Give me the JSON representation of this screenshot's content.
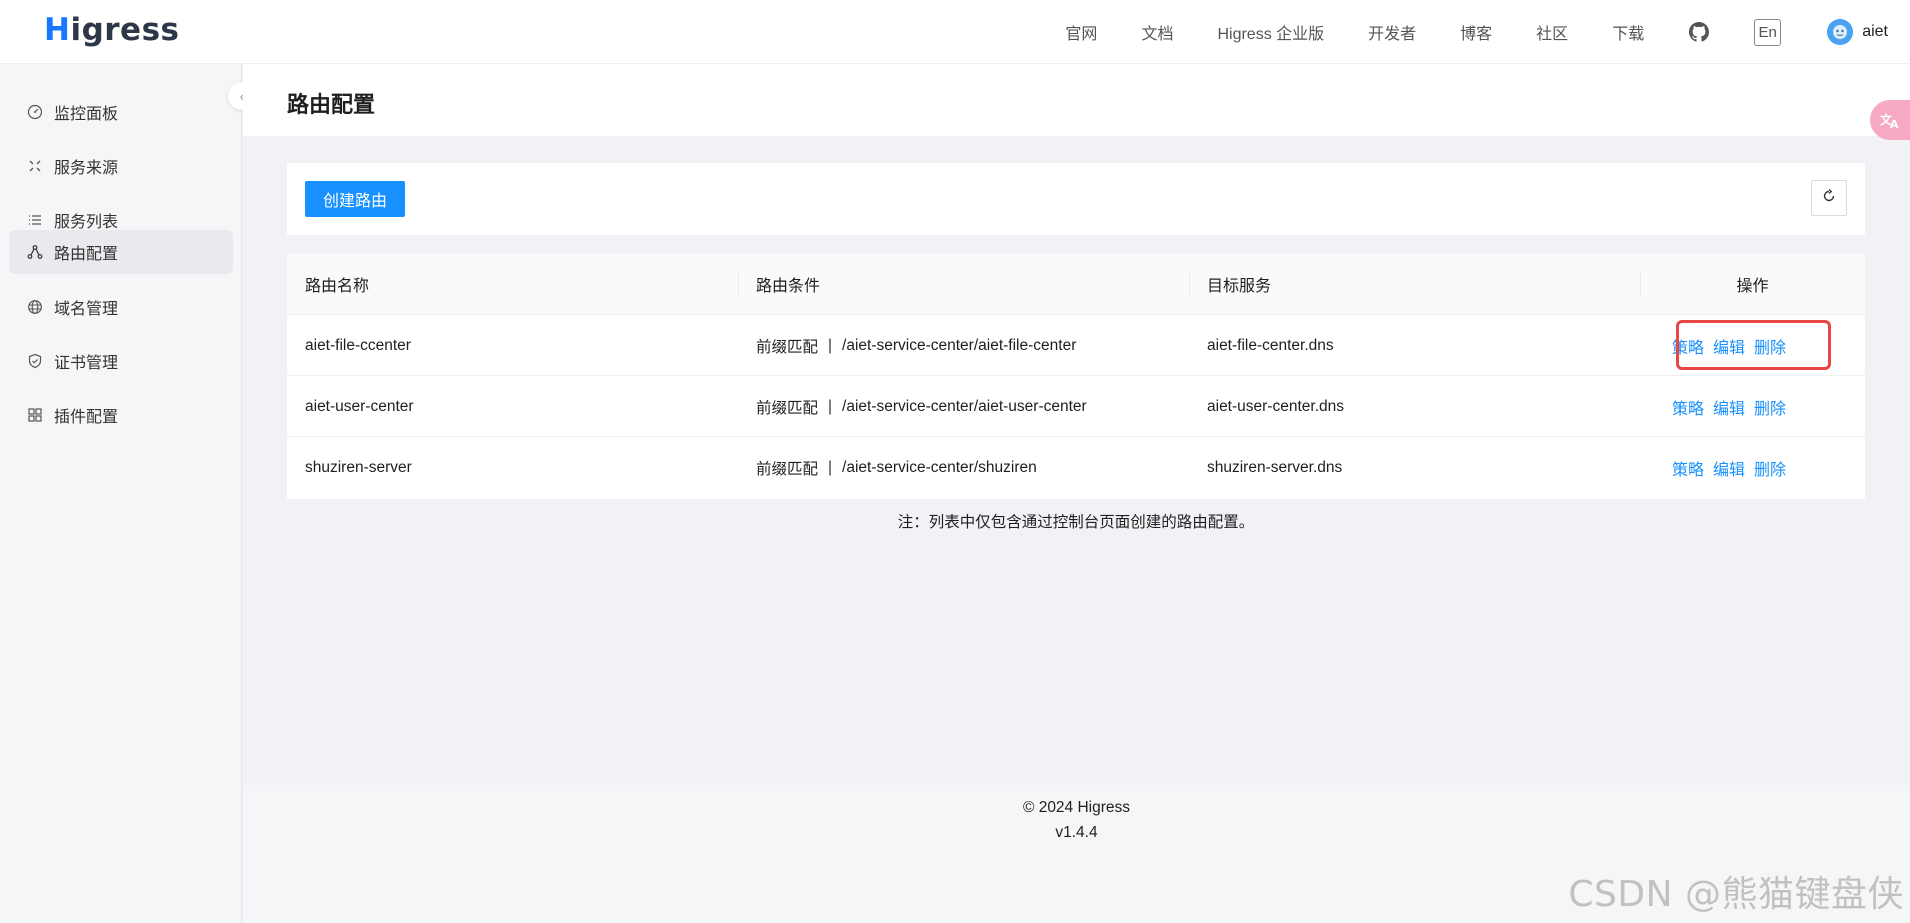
{
  "header": {
    "logo_mark": "H",
    "logo_rest": "igress",
    "nav": [
      "官网",
      "文档",
      "Higress 企业版",
      "开发者",
      "博客",
      "社区",
      "下载"
    ],
    "github_icon": "github-icon",
    "lang_label": "En",
    "user_name": "aiet"
  },
  "sidebar": {
    "items": [
      {
        "label": "监控面板",
        "icon": "dashboard-icon"
      },
      {
        "label": "服务来源",
        "icon": "source-icon"
      },
      {
        "label": "服务列表",
        "icon": "list-icon"
      },
      {
        "label": "路由配置",
        "icon": "route-icon",
        "active": true
      },
      {
        "label": "域名管理",
        "icon": "globe-icon"
      },
      {
        "label": "证书管理",
        "icon": "shield-icon"
      },
      {
        "label": "插件配置",
        "icon": "plugin-icon"
      }
    ]
  },
  "page": {
    "title": "路由配置"
  },
  "toolbar": {
    "create_label": "创建路由"
  },
  "table": {
    "columns": [
      "路由名称",
      "路由条件",
      "目标服务",
      "操作"
    ],
    "rows": [
      {
        "name": "aiet-file-ccenter",
        "match": "前缀匹配",
        "path": "/aiet-service-center/aiet-file-center",
        "service": "aiet-file-center.dns"
      },
      {
        "name": "aiet-user-center",
        "match": "前缀匹配",
        "path": "/aiet-service-center/aiet-user-center",
        "service": "aiet-user-center.dns"
      },
      {
        "name": "shuziren-server",
        "match": "前缀匹配",
        "path": "/aiet-service-center/shuziren",
        "service": "shuziren-server.dns"
      }
    ],
    "actions": [
      "策略",
      "编辑",
      "删除"
    ],
    "separator": "|"
  },
  "note": "注：列表中仅包含通过控制台页面创建的路由配置。",
  "footer": {
    "copyright": "© 2024 Higress",
    "version": "v1.4.4"
  },
  "watermark": "CSDN @熊猫键盘侠",
  "colors": {
    "primary": "#1890ff",
    "highlight": "#e84545",
    "translate_badge": "#f6a9c3"
  }
}
